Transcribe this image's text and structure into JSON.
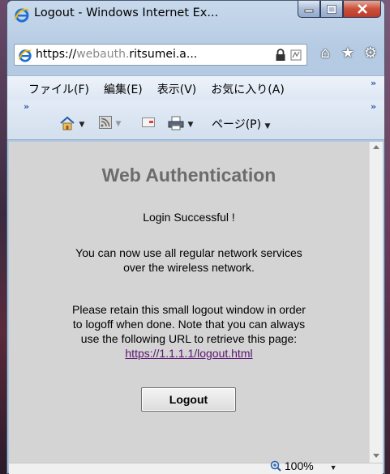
{
  "window": {
    "title": "Logout - Windows Internet Ex...",
    "caption_buttons": [
      "minimize",
      "maximize",
      "close"
    ]
  },
  "address_bar": {
    "scheme": "https://",
    "subdomain": "webauth.",
    "domain": "ritsumei.a..."
  },
  "menu": {
    "items": [
      "ファイル(F)",
      "編集(E)",
      "表示(V)",
      "お気に入り(A)"
    ]
  },
  "command_bar": {
    "page_label": "ページ(P)"
  },
  "page": {
    "heading": "Web Authentication",
    "login_status": "Login Successful !",
    "network_line1": "You can now use all regular network services",
    "network_line2": "over the wireless network.",
    "retain_line1": "Please retain this small logout window in order",
    "retain_line2": "to logoff when done. Note that you can always",
    "retain_line3": "use the following URL to retrieve this page:",
    "logout_url": "https://1.1.1.1/logout.html",
    "logout_button": "Logout"
  },
  "status_bar": {
    "zoom": "100%"
  },
  "colors": {
    "heading": "#6c6c6c",
    "link": "#5a1470",
    "content_bg": "#d4d4d4"
  }
}
